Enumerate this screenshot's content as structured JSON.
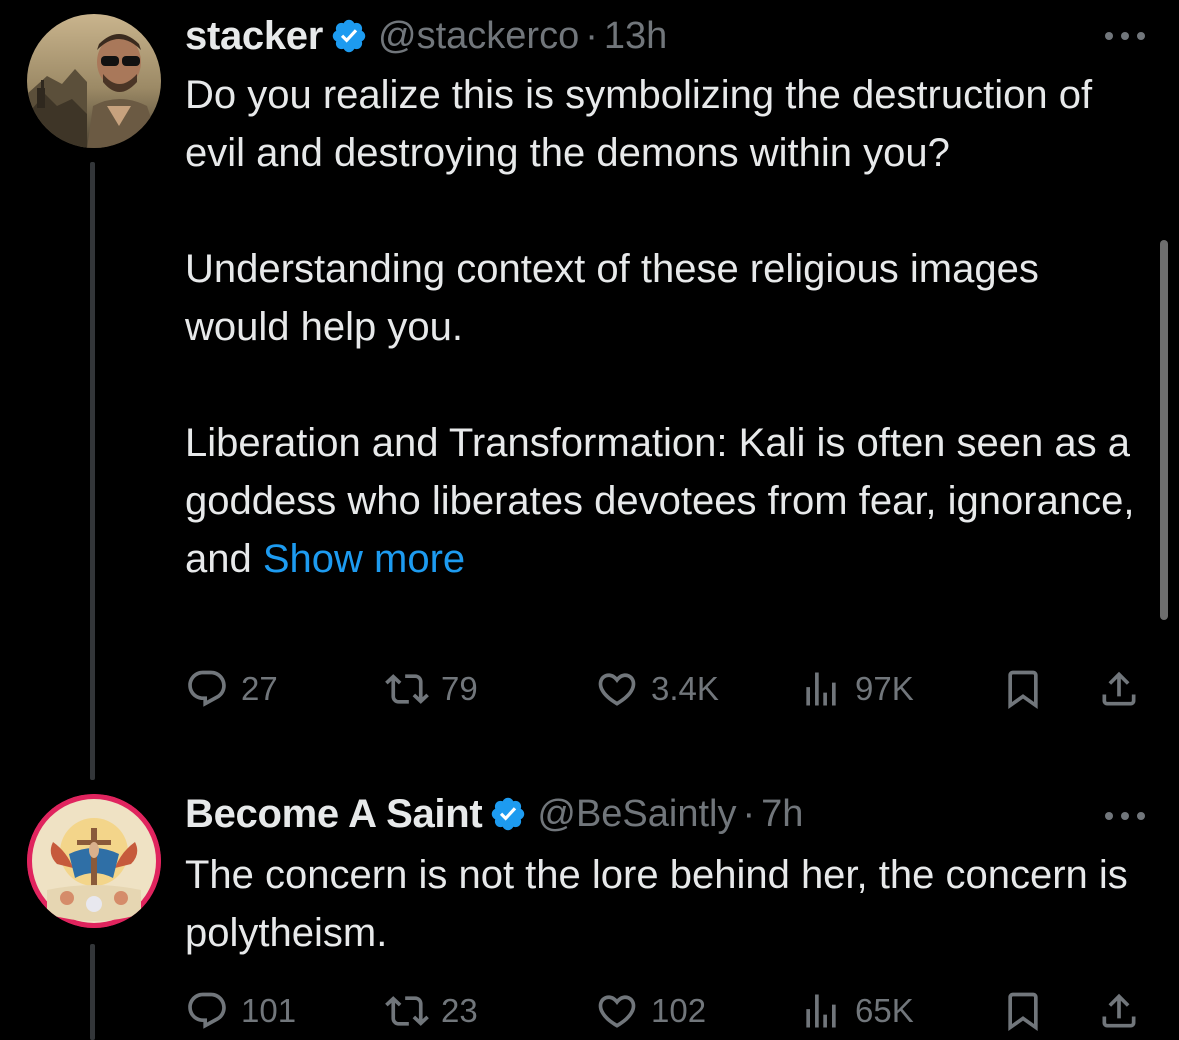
{
  "tweets": [
    {
      "display_name": "stacker",
      "handle": "@stackerco",
      "separator": "·",
      "time": "13h",
      "avatar_icon": "profile-photo-man-sunglasses",
      "paragraphs": [
        "Do you realize this is symbolizing  the destruction of evil and destroying the demons within you?",
        "Understanding context of these religious images would help you.",
        "Liberation and Transformation: Kali is often seen as a goddess who liberates devotees from fear, ignorance, and "
      ],
      "show_more": "Show more",
      "replies": "27",
      "reposts": "79",
      "likes": "3.4K",
      "views": "97K"
    },
    {
      "display_name": "Become A Saint",
      "handle": "@BeSaintly",
      "separator": "·",
      "time": "7h",
      "avatar_icon": "profile-photo-religious-painting",
      "paragraphs": [
        "The concern is not the lore behind her, the concern is polytheism."
      ],
      "replies": "101",
      "reposts": "23",
      "likes": "102",
      "views": "65K"
    }
  ],
  "colors": {
    "background": "#000000",
    "text": "#e7e9ea",
    "secondary": "#71767b",
    "link": "#1d9bf0",
    "verified": "#1d9bf0",
    "avatar_ring": "#e0245e"
  }
}
